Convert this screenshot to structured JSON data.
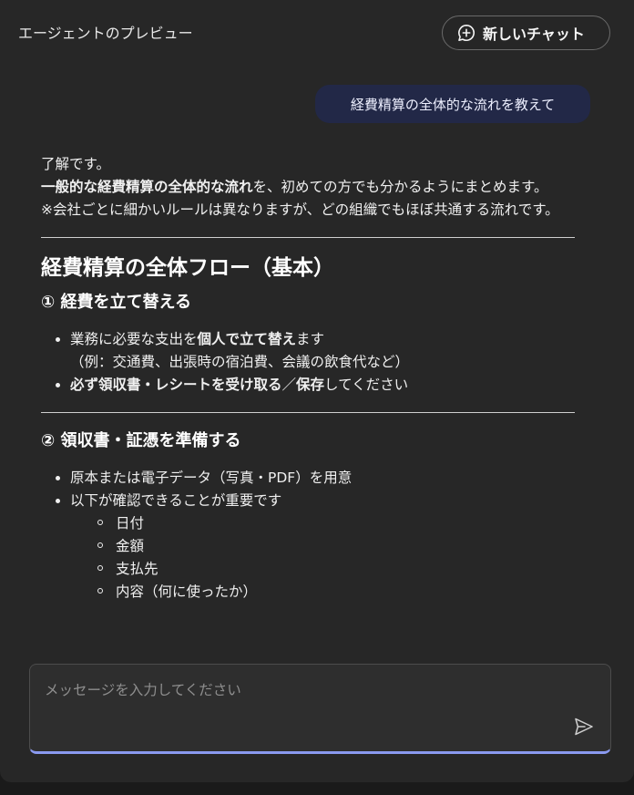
{
  "header": {
    "title": "エージェントのプレビュー",
    "new_chat_label": "新しいチャット"
  },
  "user_message": "経費精算の全体的な流れを教えて",
  "reply": {
    "intro_1": "了解です。",
    "intro_2_bold": "一般的な経費精算の全体的な流れ",
    "intro_2_rest": "を、初めての方でも分かるようにまとめます。",
    "intro_3": "※会社ごとに細かいルールは異なりますが、どの組織でもほぼ共通する流れです。",
    "heading": "経費精算の全体フロー（基本）",
    "step1": {
      "title": "① 経費を立て替える",
      "item1_pre": "業務に必要な支出を",
      "item1_bold": "個人で立て替え",
      "item1_post": "ます",
      "item1_example": "（例：交通費、出張時の宿泊費、会議の飲食代など）",
      "item2_bold_1": "必ず領収書・レシートを受け取る",
      "item2_sep": "／",
      "item2_bold_2": "保存",
      "item2_post": "してください"
    },
    "step2": {
      "title": "② 領収書・証憑を準備する",
      "item1": "原本または電子データ（写真・PDF）を用意",
      "item2": "以下が確認できることが重要です",
      "sub_items": [
        "日付",
        "金額",
        "支払先",
        "内容（何に使ったか）"
      ]
    }
  },
  "composer": {
    "placeholder": "メッセージを入力してください",
    "value": ""
  },
  "icons": {
    "new_chat": "chat-plus-icon",
    "send": "send-icon"
  },
  "colors": {
    "panel_bg": "#272727",
    "user_bubble_bg": "#222847",
    "input_focus_line": "#8a9af0"
  }
}
